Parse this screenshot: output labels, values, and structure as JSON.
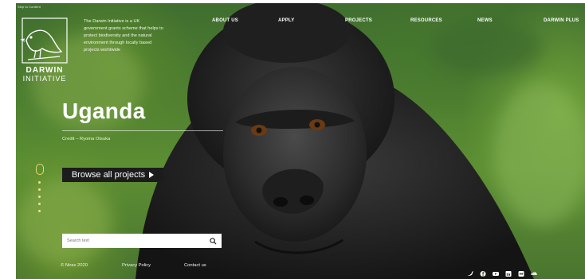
{
  "skip_link": "Skip to Content",
  "logo": {
    "line1": "DARWIN",
    "line2": "INITIATIVE"
  },
  "intro": "The Darwin Initiative is a UK government grants scheme that helps to protect biodiversity and the natural environment through locally based projects worldwide",
  "nav": [
    {
      "label": "ABOUT US"
    },
    {
      "label": "APPLY"
    },
    {
      "label": "PROJECTS"
    },
    {
      "label": "RESOURCES"
    },
    {
      "label": "NEWS"
    },
    {
      "label": "DARWIN PLUS"
    }
  ],
  "hero": {
    "title": "Uganda",
    "credit": "Credit – Ryoma Otsuka",
    "browse_label": "Browse all projects"
  },
  "search": {
    "placeholder": "Search text"
  },
  "footer": {
    "copyright": "© Niras 2020",
    "privacy": "Privacy Policy",
    "contact": "Contact us"
  },
  "social_icons": [
    "twitter-icon",
    "facebook-icon",
    "youtube-icon",
    "linkedin-icon",
    "flickr-icon",
    "soundcloud-icon"
  ],
  "colors": {
    "button_bg": "#1c1c1c",
    "accent_dots": "#f1e38a"
  }
}
